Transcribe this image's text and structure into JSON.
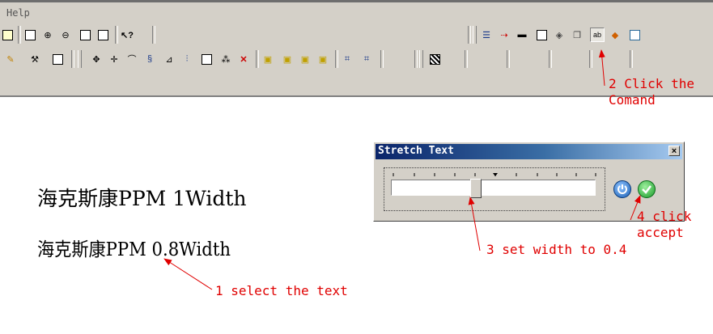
{
  "menubar": {
    "help_label": "Help"
  },
  "dialog": {
    "title": "Stretch Text",
    "close_label": "×"
  },
  "canvas": {
    "text1": "海克斯康PPM 1Width",
    "text2": "海克斯康PPM 0.8Width"
  },
  "annotations": {
    "step1": "1 select the text",
    "step2_line1": "2 Click the",
    "step2_line2": "Comand",
    "step3": "3 set width to 0.4",
    "step4_line1": "4 click",
    "step4_line2": "accept"
  },
  "colors": {
    "annotation": "#e00000",
    "toolbar_bg": "#d4d0c8",
    "title_gradient_start": "#0a246a"
  },
  "icons": [
    "zoom-window-icon",
    "zoom-in-icon",
    "zoom-out-icon",
    "zoom-extents-icon",
    "pan-icon",
    "help-pointer-icon",
    "stretch-text-icon",
    "properties-icon",
    "accept-icon",
    "power-icon"
  ]
}
